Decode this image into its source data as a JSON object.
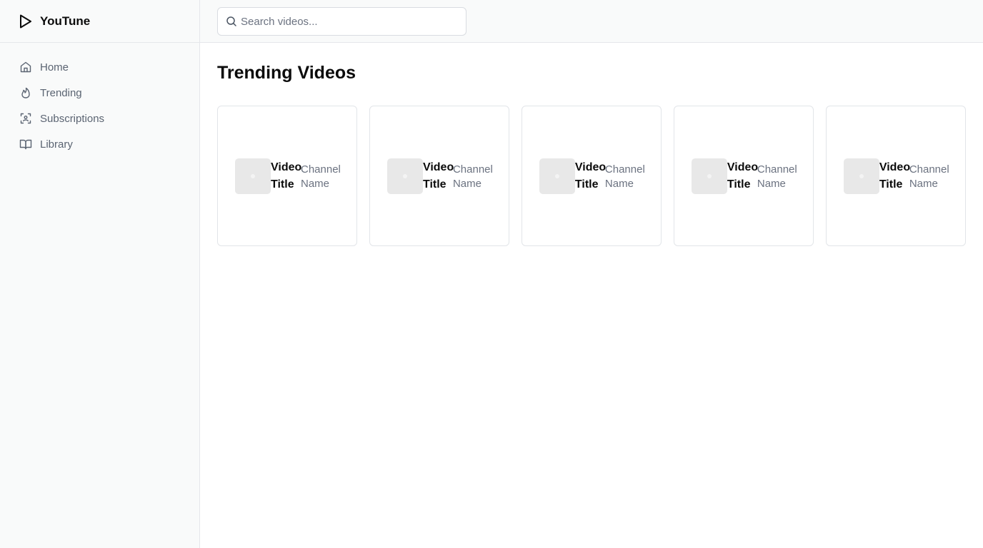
{
  "app": {
    "name": "YouTune",
    "logo_icon": "play-outline-icon"
  },
  "sidebar": {
    "items": [
      {
        "label": "Home",
        "icon": "home-icon"
      },
      {
        "label": "Trending",
        "icon": "flame-icon"
      },
      {
        "label": "Subscriptions",
        "icon": "subscriptions-scan-icon"
      },
      {
        "label": "Library",
        "icon": "book-open-icon"
      }
    ]
  },
  "search": {
    "placeholder": "Search videos...",
    "value": ""
  },
  "main": {
    "title": "Trending Videos",
    "videos": [
      {
        "title": "Video Title",
        "channel": "Channel Name"
      },
      {
        "title": "Video Title",
        "channel": "Channel Name"
      },
      {
        "title": "Video Title",
        "channel": "Channel Name"
      },
      {
        "title": "Video Title",
        "channel": "Channel Name"
      },
      {
        "title": "Video Title",
        "channel": "Channel Name"
      }
    ]
  },
  "colors": {
    "sidebar_bg": "#f9fafa",
    "border": "#e5e7eb",
    "text_primary": "#0b0b0b",
    "text_muted": "#6b7280",
    "thumbnail_bg": "#e8e8e8"
  }
}
